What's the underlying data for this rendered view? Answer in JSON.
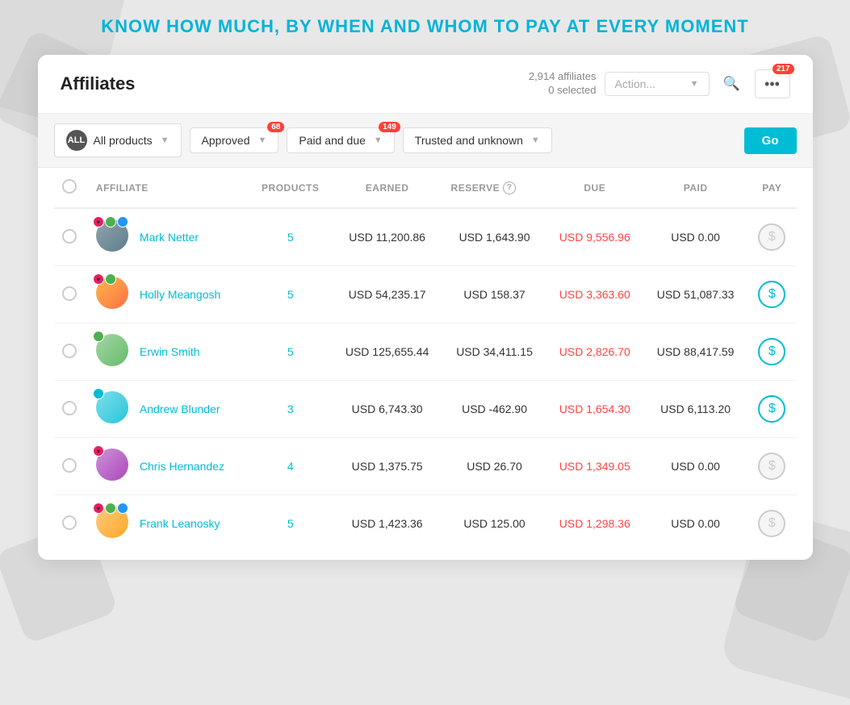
{
  "page": {
    "heading": "KNOW HOW MUCH, BY WHEN AND WHOM TO PAY AT EVERY MOMENT"
  },
  "header": {
    "title": "Affiliates",
    "affiliates_count": "2,914 affiliates",
    "selected_count": "0 selected",
    "action_placeholder": "Action...",
    "search_label": "Search",
    "more_label": "...",
    "more_badge": "217"
  },
  "filters": {
    "all_label": "ALL",
    "product_label": "All products",
    "approved_label": "Approved",
    "approved_badge": "68",
    "paid_due_label": "Paid and due",
    "paid_due_badge": "149",
    "trusted_label": "Trusted and unknown",
    "go_label": "Go"
  },
  "table": {
    "headers": [
      "",
      "AFFILIATE",
      "PRODUCTS",
      "EARNED",
      "RESERVE",
      "DUE",
      "PAID",
      "PAY"
    ],
    "reserve_help": "?",
    "rows": [
      {
        "id": 1,
        "name": "Mark Netter",
        "products": "5",
        "earned": "USD 11,200.86",
        "reserve": "USD 1,643.90",
        "due": "USD 9,556.96",
        "paid": "USD 0.00",
        "pay_active": false,
        "avatar_class": "av1",
        "badges": [
          "heart",
          "green",
          "blue"
        ]
      },
      {
        "id": 2,
        "name": "Holly Meangosh",
        "products": "5",
        "earned": "USD 54,235.17",
        "reserve": "USD 158.37",
        "due": "USD 3,363.60",
        "paid": "USD 51,087.33",
        "pay_active": true,
        "avatar_class": "av2",
        "badges": [
          "heart",
          "green"
        ]
      },
      {
        "id": 3,
        "name": "Erwin Smith",
        "products": "5",
        "earned": "USD 125,655.44",
        "reserve": "USD 34,411.15",
        "due": "USD 2,826.70",
        "paid": "USD 88,417.59",
        "pay_active": true,
        "avatar_class": "av3",
        "badges": [
          "green"
        ]
      },
      {
        "id": 4,
        "name": "Andrew Blunder",
        "products": "3",
        "earned": "USD 6,743.30",
        "reserve": "USD -462.90",
        "due": "USD 1,654.30",
        "paid": "USD 6,113.20",
        "pay_active": true,
        "avatar_class": "av4",
        "badges": [
          "teal"
        ]
      },
      {
        "id": 5,
        "name": "Chris Hernandez",
        "products": "4",
        "earned": "USD 1,375.75",
        "reserve": "USD 26.70",
        "due": "USD 1,349.05",
        "paid": "USD 0.00",
        "pay_active": false,
        "avatar_class": "av5",
        "badges": [
          "heart"
        ]
      },
      {
        "id": 6,
        "name": "Frank Leanosky",
        "products": "5",
        "earned": "USD 1,423.36",
        "reserve": "USD 125.00",
        "due": "USD 1,298.36",
        "paid": "USD 0.00",
        "pay_active": false,
        "avatar_class": "av6",
        "badges": [
          "heart",
          "green",
          "blue"
        ]
      }
    ]
  }
}
